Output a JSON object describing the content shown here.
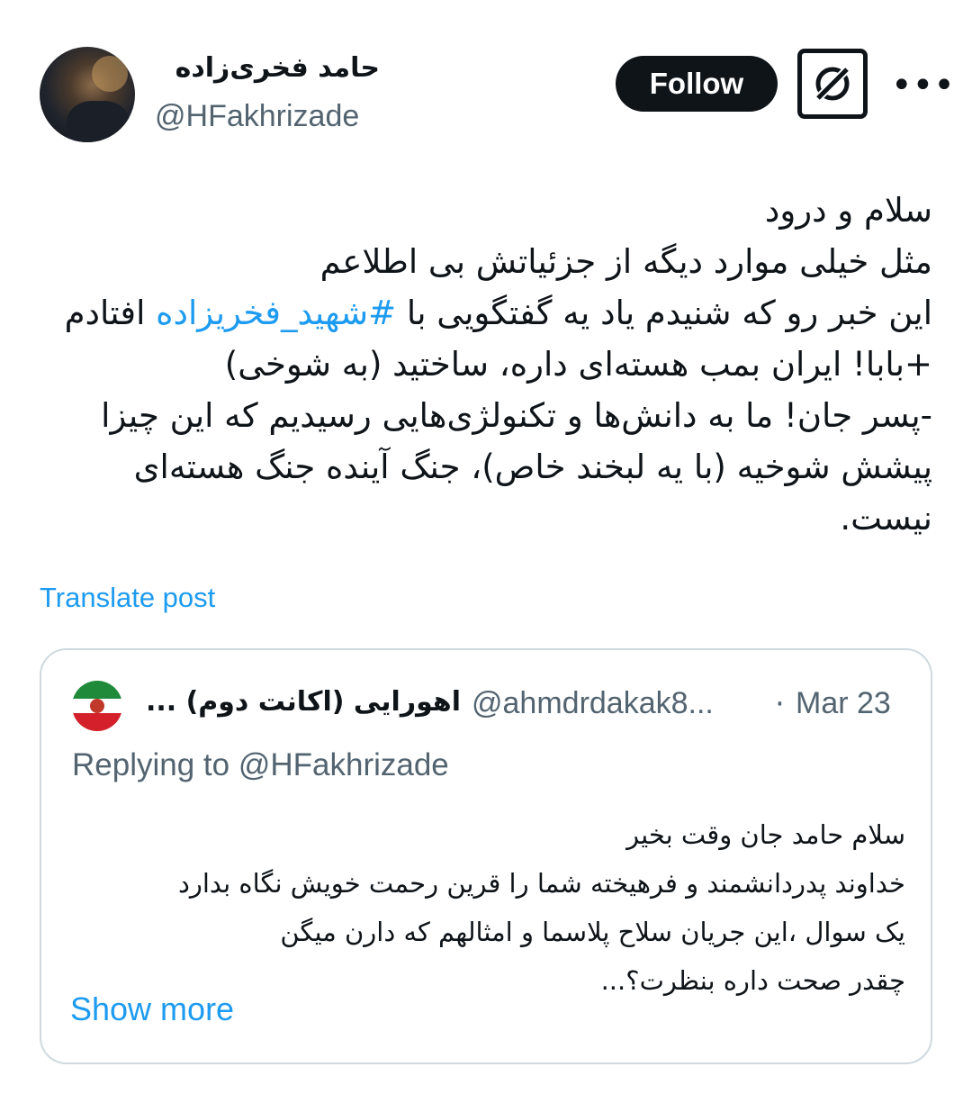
{
  "author": {
    "display_name": "حامد فخری‌زاده",
    "handle": "@HFakhrizade"
  },
  "actions": {
    "follow_label": "Follow",
    "more_label": "•••"
  },
  "post": {
    "lines": [
      "سلام و درود",
      "مثل خیلی موارد دیگه از جزئیاتش بی اطلاعم",
      "این خبر رو که شنیدم یاد یه گفتگویی با ",
      "+بابا! ایران بمب هسته‌ای داره، ساختید (به شوخی)",
      "-پسر جان! ما به دانش‌ها و تکنولژی‌هایی رسیدیم که این چیزا",
      "پیشش شوخیه (با یه لبخند خاص)، جنگ آینده جنگ هسته‌ای",
      "نیست."
    ],
    "hashtag": "#شهید_فخریزاده",
    "line3_end": " افتادم",
    "translate_label": "Translate post"
  },
  "quote": {
    "display_name": "اهورایی (اکانت دوم) ...",
    "handle": "@ahmdrdakak8...",
    "separator": "·",
    "date": "Mar 23",
    "replying_to": "Replying to @HFakhrizade",
    "lines": [
      "سلام حامد جان وقت بخیر",
      "خداوند پدردانشمند و فرهیخته شما را قرین رحمت خویش نگاه بدارد",
      "یک سوال ،این جریان سلاح پلاسما و امثالهم که دارن میگن",
      "چقدر صحت داره بنظرت؟..."
    ],
    "show_more_label": "Show more"
  },
  "colors": {
    "text": "#0f1419",
    "secondary": "#536471",
    "link": "#1d9bf0",
    "border": "#cfd9de"
  },
  "icons": {
    "grok": "grok-icon",
    "more": "more-icon"
  }
}
